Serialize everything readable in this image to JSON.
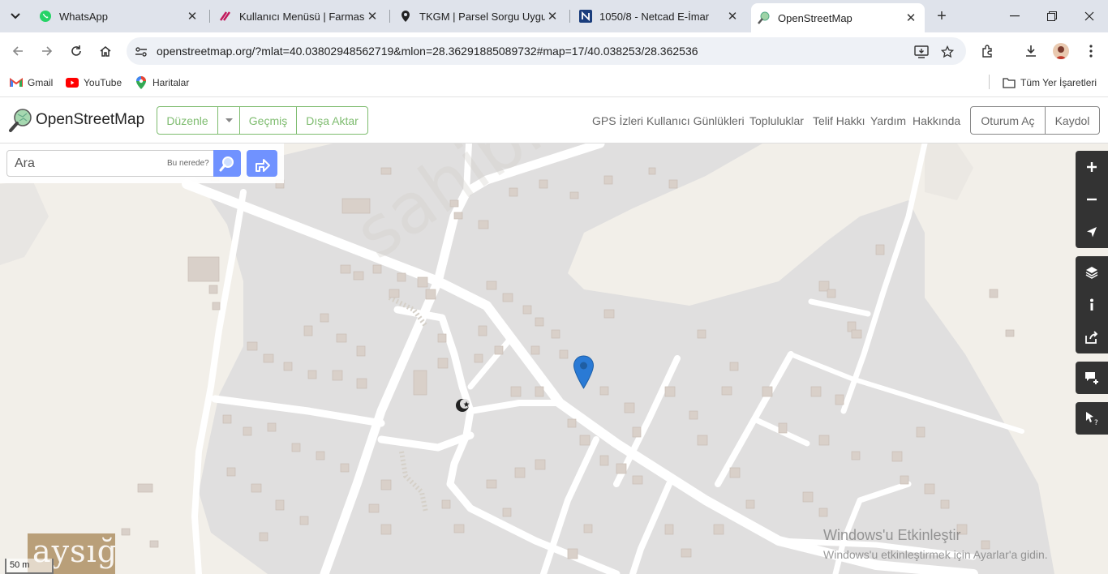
{
  "browser": {
    "tabs": [
      {
        "title": "WhatsApp",
        "icon": "whatsapp-icon"
      },
      {
        "title": "Kullanıcı Menüsü | Farmasi",
        "icon": "farmasi-icon"
      },
      {
        "title": "TKGM | Parsel Sorgu Uygulama",
        "icon": "map-pin-icon"
      },
      {
        "title": "1050/8 - Netcad E-İmar",
        "icon": "netcad-icon"
      },
      {
        "title": "OpenStreetMap",
        "icon": "osm-icon",
        "active": true
      }
    ],
    "url": "openstreetmap.org/?mlat=40.03802948562719&mlon=28.36291885089732#map=17/40.038253/28.362536"
  },
  "bookmarks": {
    "items": [
      {
        "label": "Gmail",
        "icon": "gmail-icon"
      },
      {
        "label": "YouTube",
        "icon": "youtube-icon"
      },
      {
        "label": "Haritalar",
        "icon": "maps-icon"
      }
    ],
    "all_bookmarks": "Tüm Yer İşaretleri"
  },
  "osm": {
    "brand": "OpenStreetMap",
    "edit": "Düzenle",
    "history": "Geçmiş",
    "export": "Dışa Aktar",
    "nav": [
      "GPS İzleri",
      "Kullanıcı Günlükleri",
      "Topluluklar",
      "Telif Hakkı",
      "Yardım",
      "Hakkında"
    ],
    "login": "Oturum Aç",
    "signup": "Kaydol"
  },
  "search": {
    "placeholder": "Ara",
    "where": "Bu nerede?"
  },
  "map": {
    "scale": "50 m",
    "corner_logo": "aysığ",
    "watermark": "sahibinden.com",
    "colors": {
      "background": "#f2efe9",
      "residential": "#e0dfdf",
      "building": "#d9d0c9",
      "road": "#ffffff",
      "marker": "#2a7ad5",
      "accent": "#7ebc6f",
      "button": "#7092ff"
    }
  },
  "windows": {
    "activate_title": "Windows'u Etkinleştir",
    "activate_sub": "Windows'u etkinleştirmek için Ayarlar'a gidin."
  }
}
